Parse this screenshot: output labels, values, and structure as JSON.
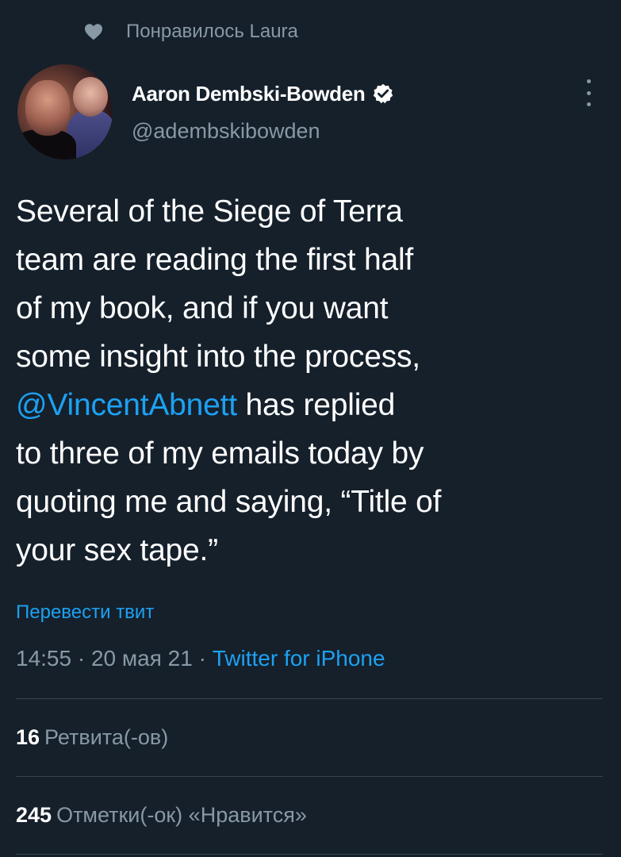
{
  "colors": {
    "background": "#15202b",
    "text_primary": "#ffffff",
    "text_secondary": "#8899a6",
    "accent": "#1da1f2",
    "divider": "#38444d"
  },
  "social_context": {
    "icon": "heart-icon",
    "text": "Понравилось Laura"
  },
  "author": {
    "display_name": "Aaron Dembski-Bowden",
    "verified_icon": "verified-badge-icon",
    "handle": "@adembskibowden"
  },
  "more_menu_icon": "more-vertical-icon",
  "tweet": {
    "text_part1": "Several of the Siege of Terra\nteam are reading the first half\nof my book, and if you want\nsome insight into the process,\n",
    "mention": "@VincentAbnett",
    "text_part2": " has replied\nto three of my emails today by\nquoting me and saying, “Title of\nyour sex tape.”"
  },
  "translate_label": "Перевести твит",
  "meta": {
    "time": "14:55",
    "separator": " · ",
    "date": "20 мая 21",
    "source": "Twitter for iPhone"
  },
  "stats": {
    "retweets_count": "16",
    "retweets_label": "Ретвита(-ов)",
    "likes_count": "245",
    "likes_label": "Отметки(-ок) «Нравится»"
  }
}
